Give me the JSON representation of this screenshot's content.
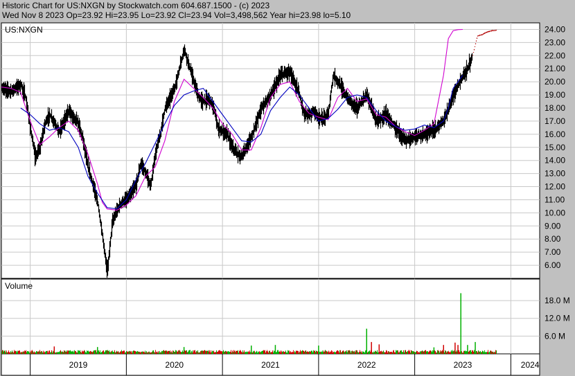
{
  "header": {
    "line1": "Historic Chart for US:NXGN by Stockwatch.com 604.687.1500 - (c) 2023",
    "line2": "Wed Nov  8 2023   Op=23.92   Hi=23.95   Lo=23.92   Cl=23.94   Vol=3,498,562   Year hi=23.98   lo=5.10"
  },
  "colors": {
    "background": "#c0c0c0",
    "plot_bg": "#ffffff",
    "grid": "#c8c8c8",
    "price_bars": "#000000",
    "ma_short": "#d000d0",
    "ma_long": "#0000c0",
    "vol_up": "#00b000",
    "vol_down": "#d00000"
  },
  "chart_data": [
    {
      "type": "line",
      "title": "US:NXGN",
      "x_ticks": [
        "2019",
        "2020",
        "2021",
        "2022",
        "2023",
        "2024"
      ],
      "y_ticks": [
        "6.00",
        "7.00",
        "8.00",
        "9.00",
        "10.00",
        "11.00",
        "12.00",
        "13.00",
        "14.00",
        "15.00",
        "16.00",
        "17.00",
        "18.00",
        "19.00",
        "20.00",
        "21.00",
        "22.00",
        "23.00",
        "24.00"
      ],
      "ylim": [
        5.0,
        24.5
      ],
      "xlim": [
        2018.7,
        2024.3
      ],
      "grid": true,
      "series": [
        {
          "style": "price",
          "x": [
            2018.7,
            2018.8,
            2018.9,
            2018.95,
            2019.0,
            2019.05,
            2019.1,
            2019.15,
            2019.2,
            2019.3,
            2019.4,
            2019.5,
            2019.55,
            2019.6,
            2019.7,
            2019.8,
            2019.85,
            2019.9,
            2019.95,
            2020.0,
            2020.05,
            2020.1,
            2020.15,
            2020.2,
            2020.25,
            2020.3,
            2020.35,
            2020.4,
            2020.5,
            2020.6,
            2020.7,
            2020.75,
            2020.8,
            2020.85,
            2020.9,
            2020.95,
            2021.0,
            2021.05,
            2021.1,
            2021.15,
            2021.2,
            2021.3,
            2021.4,
            2021.5,
            2021.6,
            2021.7,
            2021.8,
            2021.85,
            2021.9,
            2021.95,
            2022.0,
            2022.05,
            2022.1,
            2022.15,
            2022.2,
            2022.3,
            2022.4,
            2022.5,
            2022.6,
            2022.65,
            2022.7,
            2022.75,
            2022.8,
            2022.9,
            2023.0,
            2023.1,
            2023.2,
            2023.3,
            2023.4,
            2023.5,
            2023.55,
            2023.6,
            2023.65,
            2023.7,
            2023.72,
            2023.75,
            2023.8,
            2023.85
          ],
          "values": [
            19.5,
            19.3,
            19.8,
            18.8,
            16.5,
            14.2,
            15.0,
            16.8,
            17.5,
            16.2,
            17.8,
            16.8,
            15.5,
            13.5,
            10.8,
            5.5,
            9.2,
            10.2,
            10.8,
            11.0,
            11.5,
            12.2,
            13.8,
            13.0,
            12.0,
            14.5,
            16.0,
            18.0,
            19.5,
            22.5,
            20.0,
            18.8,
            18.5,
            18.7,
            18.2,
            16.5,
            16.2,
            16.0,
            15.0,
            14.5,
            14.3,
            15.8,
            18.0,
            19.0,
            20.5,
            20.8,
            19.0,
            17.5,
            17.5,
            17.8,
            17.2,
            17.2,
            17.6,
            20.5,
            20.0,
            18.7,
            18.0,
            19.0,
            17.0,
            17.2,
            17.5,
            17.0,
            16.5,
            15.5,
            15.8,
            16.0,
            16.3,
            17.0,
            19.0,
            20.5,
            21.0,
            22.0,
            23.5,
            23.6,
            23.7,
            23.8,
            23.9,
            23.94
          ]
        },
        {
          "style": "ma_short",
          "x": [
            2018.7,
            2018.8,
            2018.9,
            2019.0,
            2019.1,
            2019.2,
            2019.3,
            2019.4,
            2019.5,
            2019.6,
            2019.7,
            2019.75,
            2019.8,
            2019.9,
            2020.0,
            2020.1,
            2020.2,
            2020.3,
            2020.4,
            2020.5,
            2020.6,
            2020.7,
            2020.8,
            2020.9,
            2021.0,
            2021.1,
            2021.2,
            2021.3,
            2021.4,
            2021.5,
            2021.6,
            2021.7,
            2021.8,
            2021.9,
            2022.0,
            2022.1,
            2022.2,
            2022.3,
            2022.4,
            2022.5,
            2022.6,
            2022.7,
            2022.8,
            2022.9,
            2023.0,
            2023.1,
            2023.2,
            2023.3,
            2023.35,
            2023.4,
            2023.45,
            2023.5
          ],
          "values": [
            19.6,
            19.5,
            19.2,
            17.0,
            15.2,
            15.8,
            16.5,
            17.0,
            16.3,
            14.5,
            12.2,
            10.8,
            10.3,
            10.2,
            10.6,
            11.3,
            12.8,
            13.5,
            15.5,
            18.5,
            20.2,
            19.5,
            18.8,
            18.0,
            16.8,
            16.0,
            14.8,
            14.8,
            16.5,
            18.8,
            19.8,
            20.0,
            18.5,
            17.6,
            17.3,
            17.1,
            18.8,
            19.5,
            18.5,
            18.7,
            17.5,
            17.3,
            16.6,
            16.2,
            15.9,
            16.3,
            16.8,
            20.5,
            23.3,
            23.9,
            23.98,
            24.0
          ]
        },
        {
          "style": "ma_long",
          "x": [
            2018.9,
            2019.0,
            2019.1,
            2019.2,
            2019.3,
            2019.4,
            2019.5,
            2019.6,
            2019.7,
            2019.8,
            2019.9,
            2020.0,
            2020.1,
            2020.2,
            2020.3,
            2020.4,
            2020.5,
            2020.6,
            2020.7,
            2020.8,
            2020.9,
            2021.0,
            2021.1,
            2021.2,
            2021.3,
            2021.4,
            2021.5,
            2021.6,
            2021.7,
            2021.8,
            2021.9,
            2022.0,
            2022.1,
            2022.2,
            2022.3,
            2022.4,
            2022.5,
            2022.6,
            2022.7,
            2022.8,
            2022.9,
            2023.0,
            2023.1,
            2023.2,
            2023.3,
            2023.35,
            2023.4,
            2023.5
          ],
          "values": [
            18.0,
            17.5,
            16.8,
            16.3,
            16.5,
            16.2,
            15.0,
            12.8,
            11.5,
            10.4,
            10.3,
            11.0,
            12.5,
            13.8,
            15.3,
            16.8,
            18.2,
            19.0,
            19.3,
            19.5,
            18.5,
            17.5,
            16.5,
            15.5,
            15.4,
            16.0,
            17.8,
            18.8,
            19.6,
            19.0,
            18.0,
            17.0,
            17.2,
            17.9,
            18.8,
            19.0,
            18.8,
            17.8,
            17.0,
            16.6,
            16.3,
            16.4,
            16.7,
            16.5,
            17.0,
            18.0,
            19.5,
            20.5
          ]
        }
      ]
    },
    {
      "type": "bar",
      "title": "Volume",
      "y_ticks": [
        "6.0 M",
        "12.0 M",
        "18.0 M"
      ],
      "ylim": [
        0,
        22
      ],
      "xlim": [
        2018.7,
        2024.3
      ],
      "grid": true,
      "spikes": {
        "x": [
          2019.25,
          2019.7,
          2020.6,
          2021.3,
          2021.55,
          2022.0,
          2022.5,
          2022.55,
          2022.63,
          2023.2,
          2023.3,
          2023.42,
          2023.45,
          2023.48,
          2023.55,
          2023.63
        ],
        "values": [
          2.5,
          2.3,
          2.3,
          2.8,
          3.0,
          2.8,
          8.5,
          4.0,
          3.2,
          2.2,
          3.0,
          3.8,
          3.0,
          20.5,
          3.0,
          4.0
        ],
        "up": [
          false,
          true,
          true,
          true,
          true,
          true,
          true,
          false,
          false,
          true,
          false,
          false,
          false,
          true,
          true,
          true
        ]
      }
    }
  ]
}
